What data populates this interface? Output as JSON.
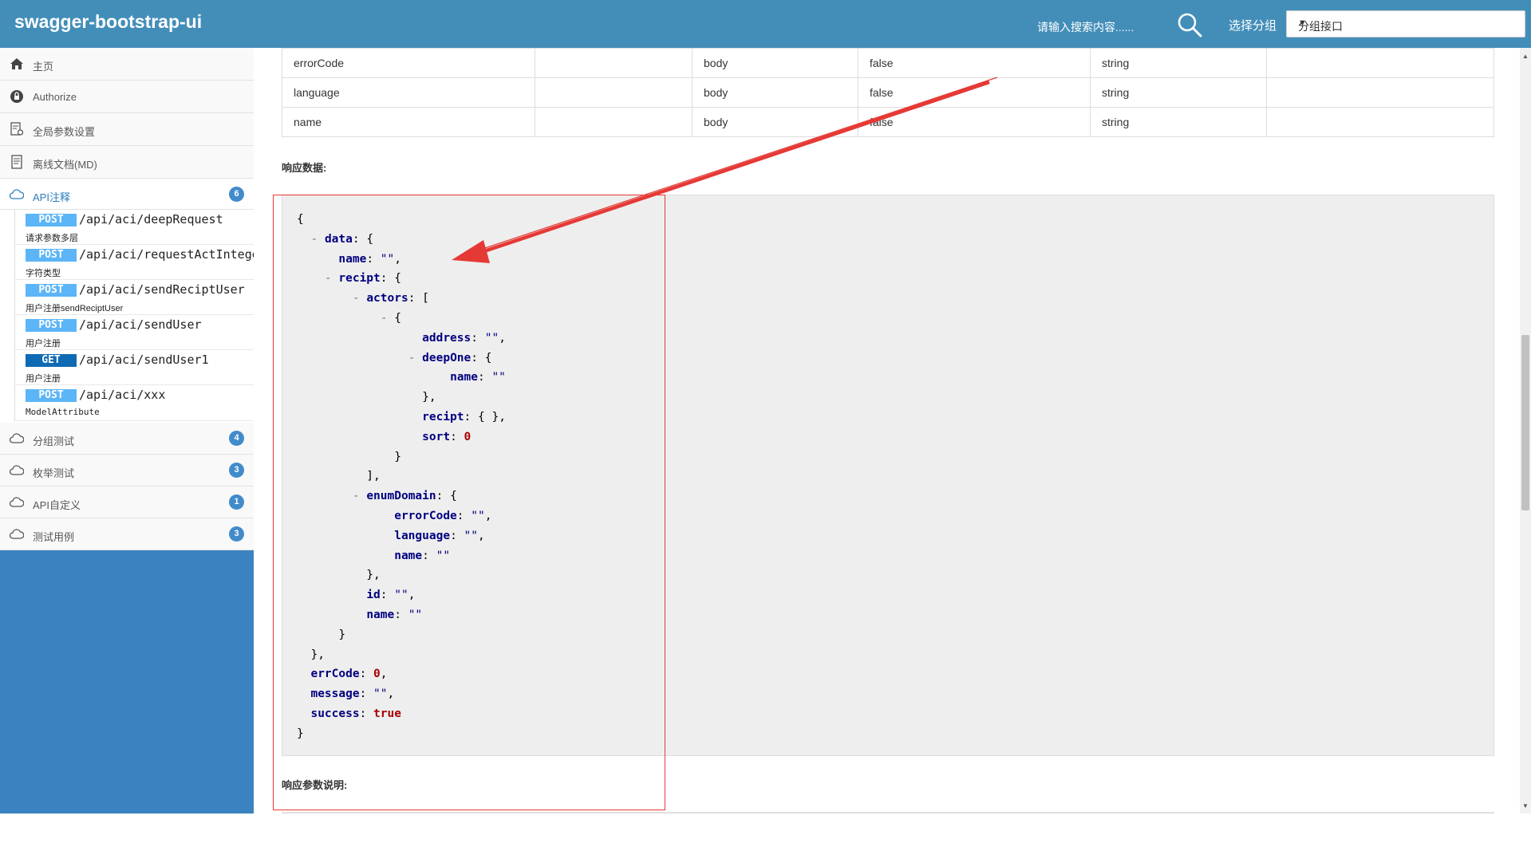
{
  "header": {
    "brand": "swagger-bootstrap-ui",
    "search_placeholder": "请输入搜索内容......",
    "group_label": "选择分组",
    "group_selected": "分组接口"
  },
  "sidebar": {
    "home": "主页",
    "authorize": "Authorize",
    "global_params": "全局参数设置",
    "offline_doc": "离线文档(MD)",
    "api_notes": {
      "label": "API注释",
      "count": "6"
    },
    "apis": [
      {
        "method": "POST",
        "path": "/api/aci/deepRequest",
        "desc": "请求参数多层"
      },
      {
        "method": "POST",
        "path": "/api/aci/requestActInteger",
        "desc": "字符类型"
      },
      {
        "method": "POST",
        "path": "/api/aci/sendReciptUser",
        "desc": "用户注册sendReciptUser"
      },
      {
        "method": "POST",
        "path": "/api/aci/sendUser",
        "desc": "用户注册"
      },
      {
        "method": "GET",
        "path": "/api/aci/sendUser1",
        "desc": "用户注册"
      },
      {
        "method": "POST",
        "path": "/api/aci/xxx",
        "desc": "ModelAttribute"
      }
    ],
    "group_test": {
      "label": "分组测试",
      "count": "4"
    },
    "enum_test": {
      "label": "枚举测试",
      "count": "3"
    },
    "api_custom": {
      "label": "API自定义",
      "count": "1"
    },
    "test_cases": {
      "label": "测试用例",
      "count": "3"
    }
  },
  "params_table": [
    [
      "errorCode",
      "",
      "body",
      "false",
      "string",
      ""
    ],
    [
      "language",
      "",
      "body",
      "false",
      "string",
      ""
    ],
    [
      "name",
      "",
      "body",
      "false",
      "string",
      ""
    ]
  ],
  "response": {
    "title": "响应数据:",
    "params_title": "响应参数说明:",
    "json": {
      "data": {
        "name": "\"\"",
        "recipt": {
          "actors": {
            "address": "\"\"",
            "deepOne_name": "\"\"",
            "recipt": "{ }",
            "sort": "0"
          },
          "enumDomain": {
            "errorCode": "\"\"",
            "language": "\"\"",
            "name": "\"\""
          },
          "id": "\"\"",
          "name": "\"\""
        }
      },
      "errCode": "0",
      "message": "\"\"",
      "success": "true"
    }
  },
  "colors": {
    "header": "#438EB9",
    "sidebar": "#3B83C0",
    "post": "#5CB5F7",
    "get": "#0F6AB4",
    "annotation": "#e53935"
  }
}
